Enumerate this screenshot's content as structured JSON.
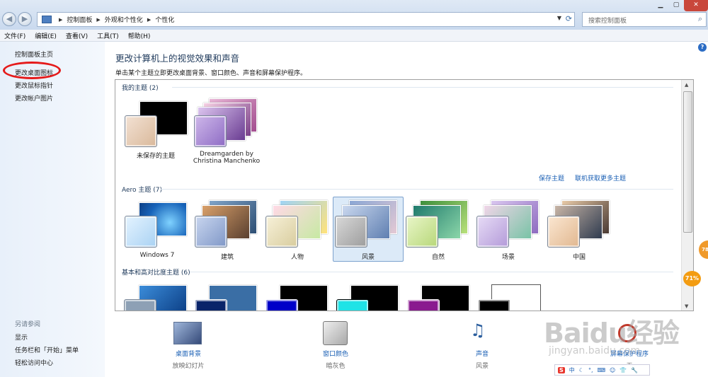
{
  "address": {
    "crumbs": [
      "控制面板",
      "外观和个性化",
      "个性化"
    ],
    "search_placeholder": "搜索控制面板"
  },
  "menu": [
    "文件(F)",
    "编辑(E)",
    "查看(V)",
    "工具(T)",
    "帮助(H)"
  ],
  "sidebar": {
    "links": [
      "控制面板主页",
      "更改桌面图标",
      "更改鼠标指针",
      "更改帐户图片"
    ],
    "see_also": "另请参阅",
    "see_also_links": [
      "显示",
      "任务栏和「开始」菜单",
      "轻松访问中心"
    ]
  },
  "main": {
    "title": "更改计算机上的视觉效果和声音",
    "subtitle": "单击某个主题立即更改桌面背景、窗口颜色、声音和屏幕保护程序。",
    "my_themes": {
      "header": "我的主题 (2)",
      "items": [
        "未保存的主题",
        "Dreamgarden by Christina Manchenko"
      ]
    },
    "save_theme": "保存主题",
    "get_more": "联机获取更多主题",
    "aero": {
      "header": "Aero 主题 (7)",
      "items": [
        "Windows 7",
        "建筑",
        "人物",
        "风景",
        "自然",
        "场景",
        "中国"
      ],
      "selected": "风景"
    },
    "basic": {
      "header": "基本和高对比度主题 (6)"
    }
  },
  "bottom": [
    {
      "label": "桌面背景",
      "sub": "放映幻灯片"
    },
    {
      "label": "窗口颜色",
      "sub": "暗灰色"
    },
    {
      "label": "声音",
      "sub": "风景"
    },
    {
      "label": "屏幕保护程序",
      "sub": "无"
    }
  ],
  "overlay": {
    "badge_a": "71%",
    "badge_b": "78",
    "watermark_logo": "Baidu经验",
    "watermark_url": "jingyan.baidu.com",
    "ime": [
      "S",
      "中",
      "☾",
      "°,",
      "⌨",
      "☺",
      "👕",
      "🔧"
    ]
  },
  "colors": {
    "accent": "#1a5fb4",
    "title": "#1e395b",
    "highlight_ring": "#e51a1a"
  }
}
